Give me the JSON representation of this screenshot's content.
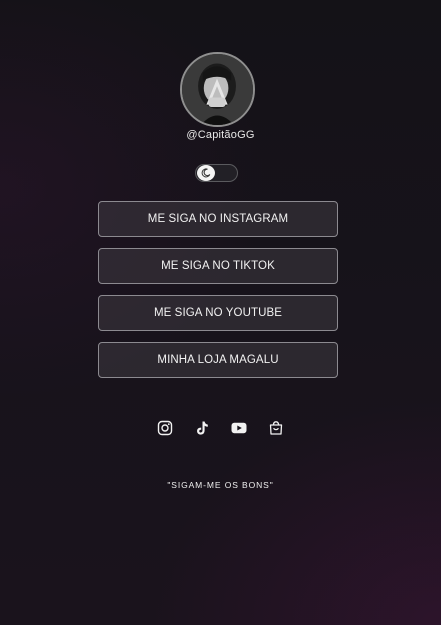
{
  "profile": {
    "username": "@CapitãoGG",
    "avatar_alt": "profile photo"
  },
  "theme_toggle": {
    "icon": "moon-icon",
    "state": "dark"
  },
  "links": [
    {
      "label": "ME SIGA NO INSTAGRAM"
    },
    {
      "label": "ME SIGA NO TIKTOK"
    },
    {
      "label": "ME SIGA NO YOUTUBE"
    },
    {
      "label": "MINHA LOJA MAGALU"
    }
  ],
  "socials": [
    {
      "icon": "instagram-icon"
    },
    {
      "icon": "tiktok-icon"
    },
    {
      "icon": "youtube-icon"
    },
    {
      "icon": "shopping-bag-icon"
    }
  ],
  "tagline": "\"SIGAM-ME OS BONS\"",
  "colors": {
    "background": "#17131b",
    "button_border": "#8c8a90",
    "text": "#f2f2f2"
  }
}
